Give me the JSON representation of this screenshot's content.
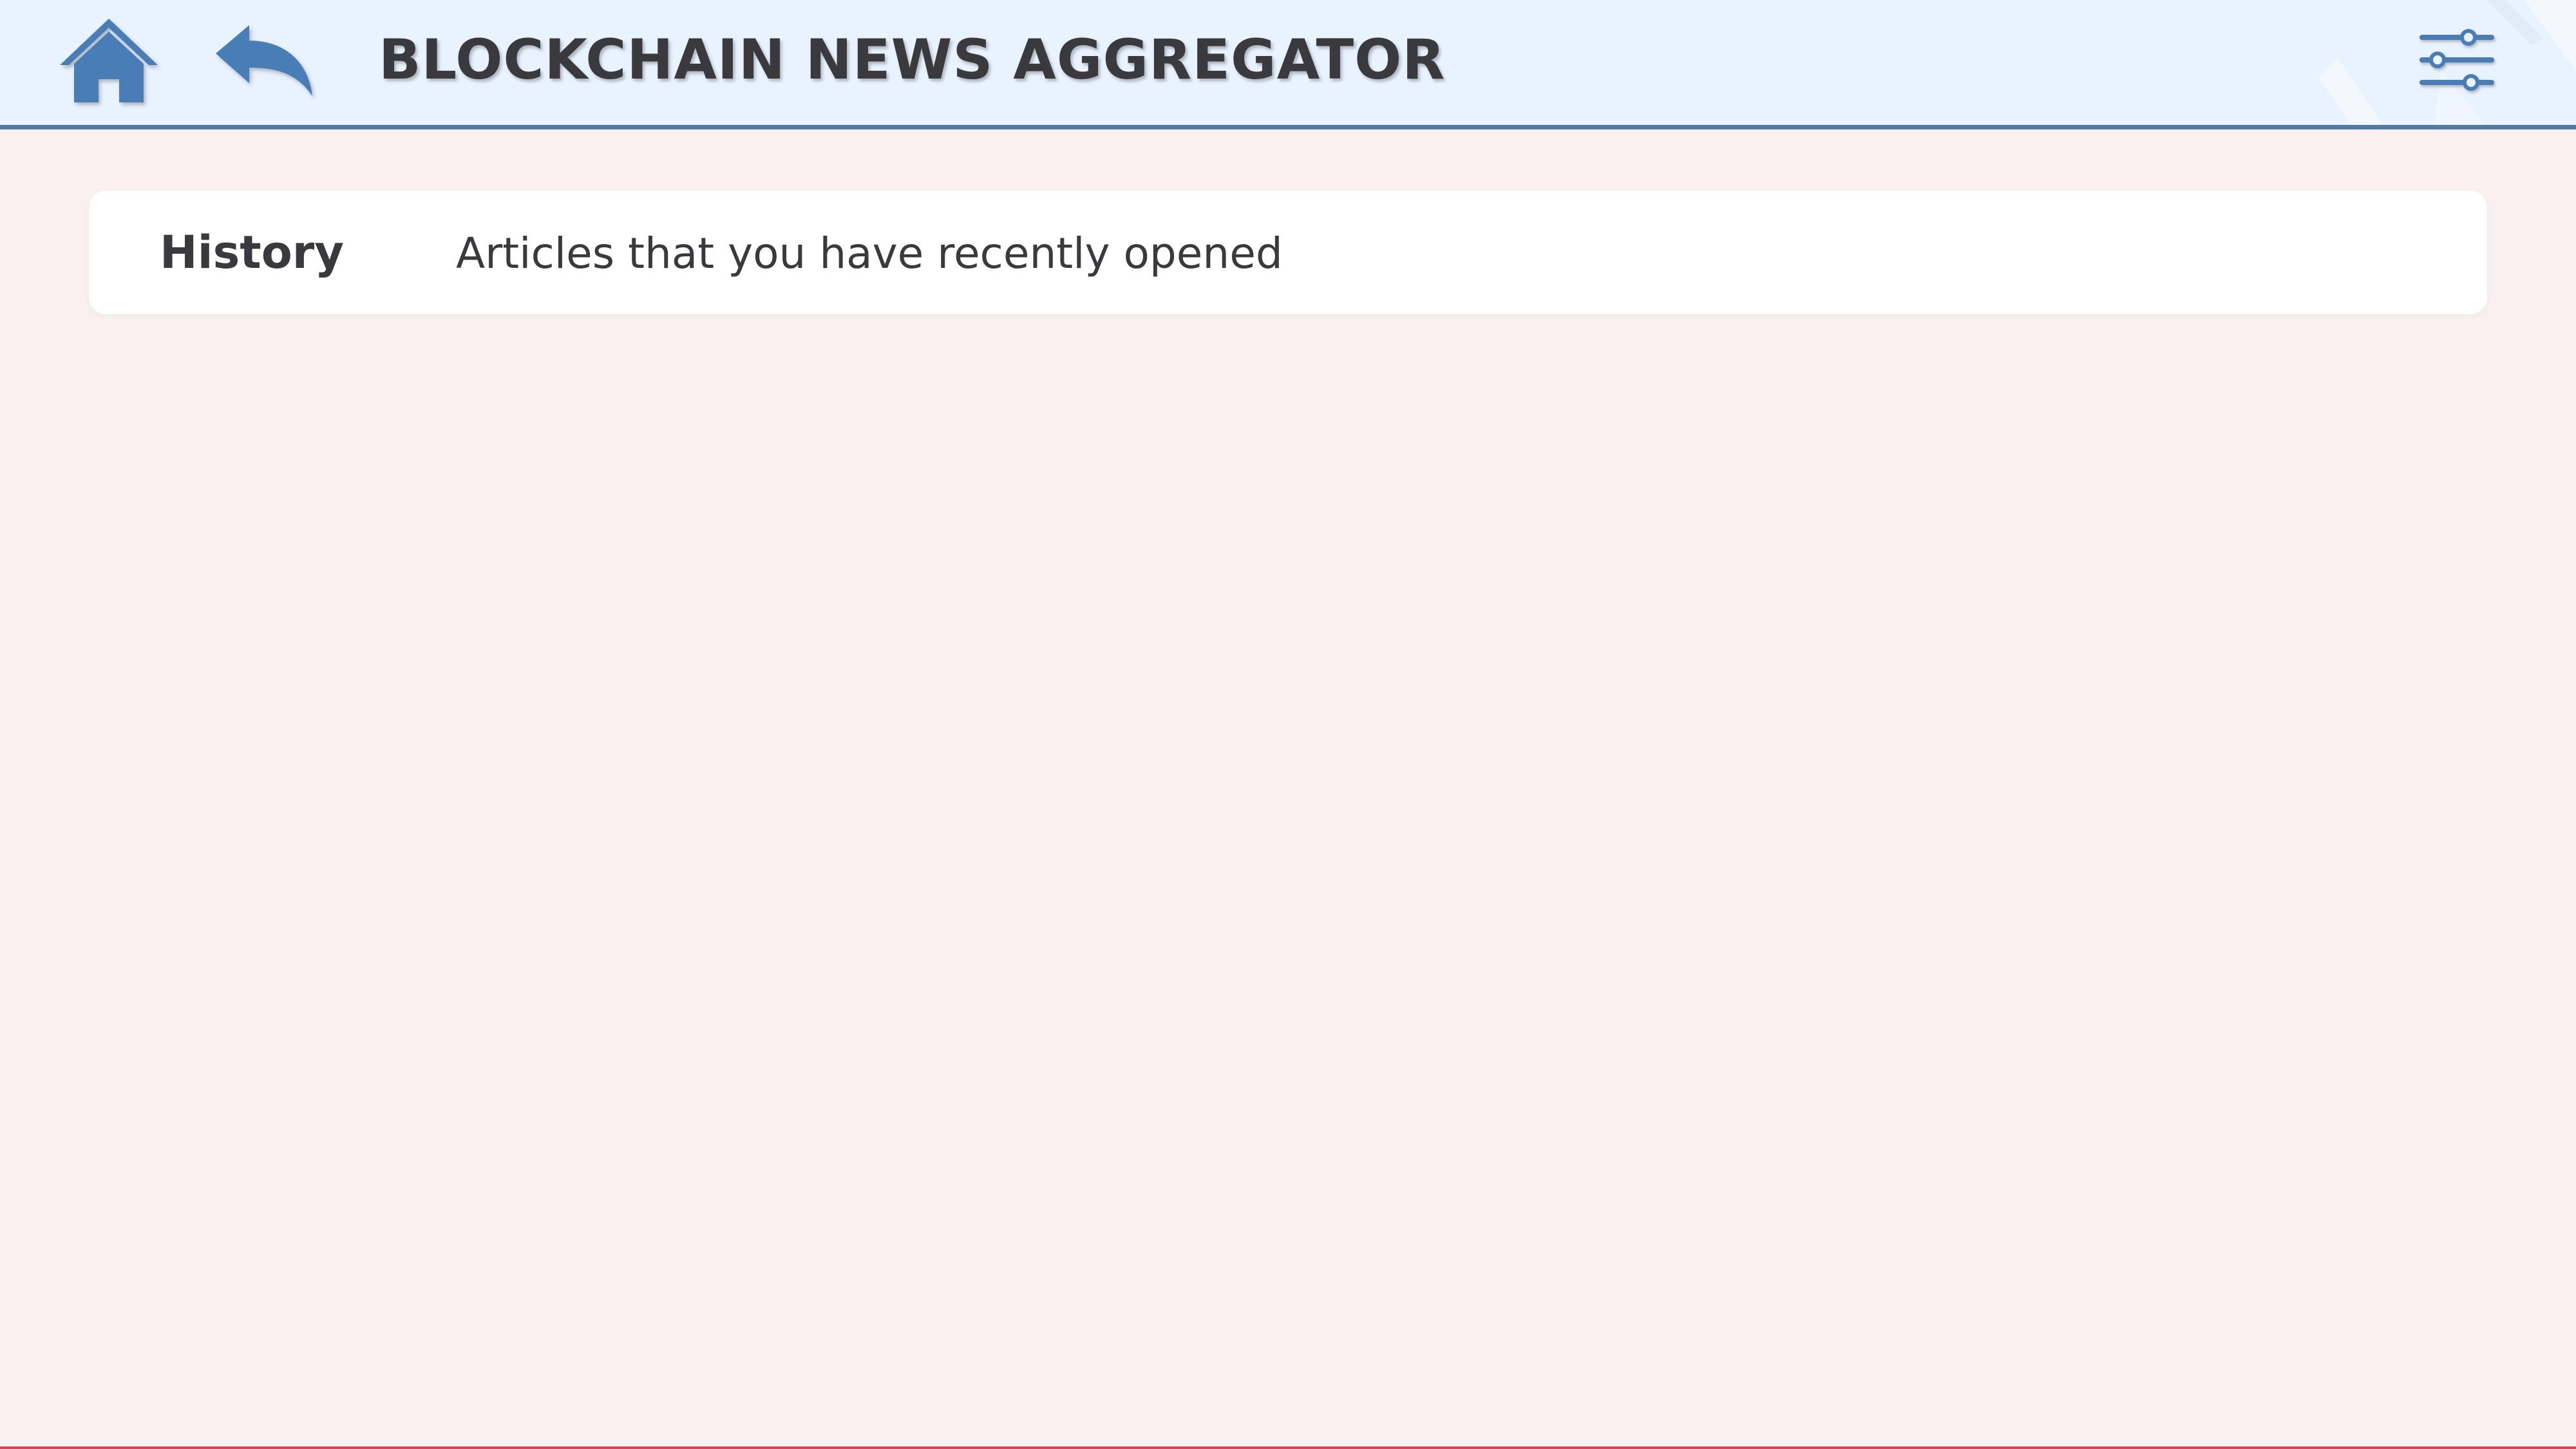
{
  "app": {
    "title": "BLOCKCHAIN NEWS AGGREGATOR"
  },
  "toolbar": {
    "home_icon": "home-icon",
    "back_icon": "back-arrow-icon",
    "settings_icon": "sliders-icon"
  },
  "history": {
    "title": "History",
    "subtitle": "Articles that you have recently opened"
  },
  "colors": {
    "topbar_background": "#e9f2ff",
    "accent": "#4e7aa6",
    "page_background": "#fbf0f1",
    "card_background": "#ffffff",
    "text": "#3a3a3e"
  }
}
